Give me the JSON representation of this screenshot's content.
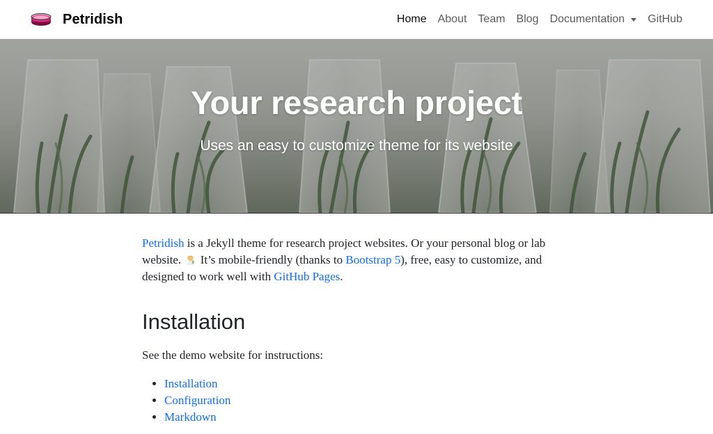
{
  "navbar": {
    "brand": "Petridish",
    "links": [
      {
        "label": "Home"
      },
      {
        "label": "About"
      },
      {
        "label": "Team"
      },
      {
        "label": "Blog"
      },
      {
        "label": "Documentation"
      },
      {
        "label": "GitHub"
      }
    ]
  },
  "hero": {
    "title": "Your research project",
    "subtitle": "Uses an easy to customize theme for its website"
  },
  "intro": {
    "link_petridish": "Petridish",
    "text_1": " is a Jekyll theme for research project websites. Or your personal blog or lab website. ",
    "emoji": "scientist-emoji",
    "text_2": " It’s mobile-friendly (thanks to ",
    "link_bootstrap": "Bootstrap 5",
    "text_3": "), free, easy to customize, and designed to work well with ",
    "link_github_pages": "GitHub Pages",
    "text_4": "."
  },
  "installation": {
    "heading": "Installation",
    "text": "See the demo website for instructions:",
    "links": [
      {
        "label": "Installation"
      },
      {
        "label": "Configuration"
      },
      {
        "label": "Markdown"
      }
    ]
  },
  "colors": {
    "link": "#0d6efd",
    "text": "#212529"
  }
}
